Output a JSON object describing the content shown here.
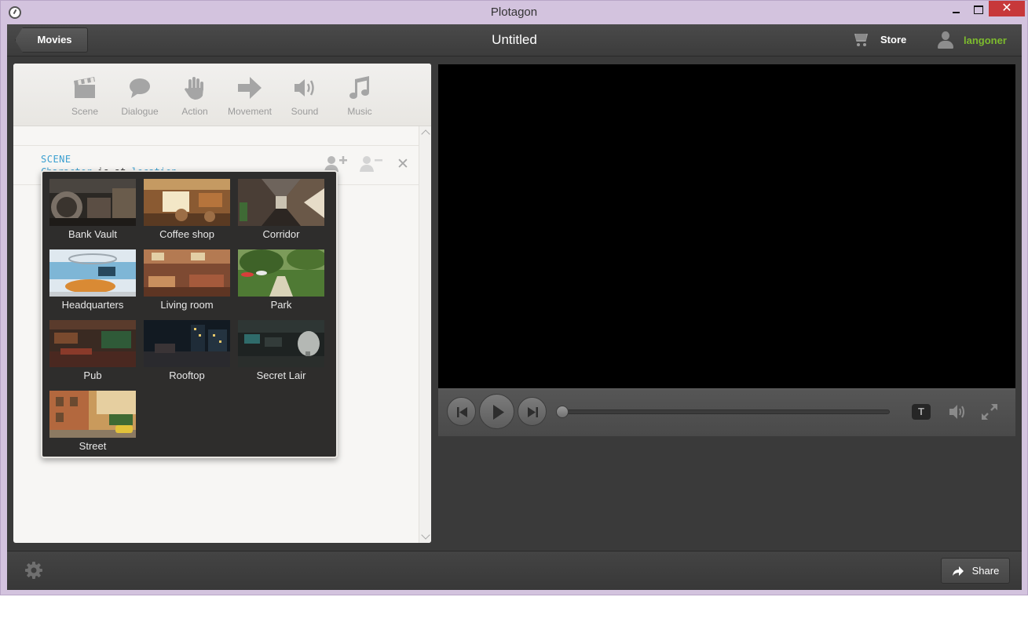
{
  "window": {
    "title": "Plotagon",
    "close_glyph": "✕"
  },
  "header": {
    "back_button": "Movies",
    "title": "Untitled",
    "store_label": "Store",
    "username": "langoner"
  },
  "toolbar": {
    "items": [
      {
        "label": "Scene",
        "icon": "clapperboard-icon"
      },
      {
        "label": "Dialogue",
        "icon": "speech-bubble-icon"
      },
      {
        "label": "Action",
        "icon": "hand-icon"
      },
      {
        "label": "Movement",
        "icon": "arrow-right-icon"
      },
      {
        "label": "Sound",
        "icon": "speaker-icon"
      },
      {
        "label": "Music",
        "icon": "music-note-icon"
      }
    ]
  },
  "script_line": {
    "tag": "SCENE",
    "character_placeholder": "Character",
    "verb": " is at ",
    "location_placeholder": "location"
  },
  "locations": [
    {
      "label": "Bank Vault"
    },
    {
      "label": "Coffee shop"
    },
    {
      "label": "Corridor"
    },
    {
      "label": "Headquarters"
    },
    {
      "label": "Living room"
    },
    {
      "label": "Park"
    },
    {
      "label": "Pub"
    },
    {
      "label": "Rooftop"
    },
    {
      "label": "Secret Lair"
    },
    {
      "label": "Street"
    }
  ],
  "player": {
    "subtitle_glyph": "T",
    "progress": 0
  },
  "bottom": {
    "share_label": "Share"
  },
  "colors": {
    "accent_link": "#3a9fd0",
    "username": "#7dbb2e",
    "window_frame": "#d3c3de",
    "close_button": "#c7383a"
  }
}
